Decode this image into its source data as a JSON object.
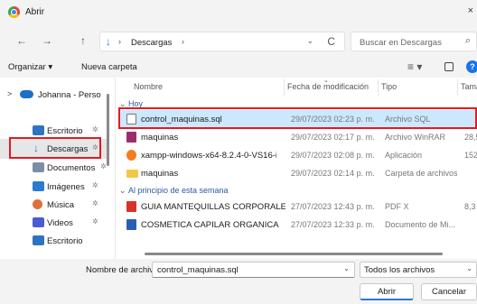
{
  "window": {
    "title": "Abrir",
    "close_glyph": "×"
  },
  "nav": {
    "back_glyph": "←",
    "forward_glyph": "→",
    "up_glyph": "↑",
    "location_icon_glyph": "↓",
    "path_separator": "›",
    "breadcrumb": "Descargas",
    "path_dropdown_glyph": "⌄",
    "refresh_glyph": "C"
  },
  "search": {
    "placeholder": "Buscar en Descargas",
    "icon_glyph": "⌕"
  },
  "toolbar": {
    "organize": "Organizar ▾",
    "new_folder": "Nueva carpeta",
    "view_glyph": "≡ ▾",
    "help_glyph": "?"
  },
  "sidebar": {
    "top_item": {
      "label": "Johanna - Perso",
      "expand_glyph": ">"
    },
    "items": [
      {
        "label": "Escritorio",
        "pin": "✲",
        "color": "#2f74c0"
      },
      {
        "label": "Descargas",
        "pin": "✲",
        "color": "#2b79d0",
        "glyph": "↓"
      },
      {
        "label": "Documentos",
        "pin": "✲",
        "color": "#7a8ea8"
      },
      {
        "label": "Imágenes",
        "pin": "✲",
        "color": "#2b79d0"
      },
      {
        "label": "Música",
        "pin": "✲",
        "color": "#e0703a"
      },
      {
        "label": "Videos",
        "pin": "✲",
        "color": "#4a5bd6"
      },
      {
        "label": "Escritorio",
        "pin": "",
        "color": "#2f74c0"
      }
    ]
  },
  "columns": {
    "name": "Nombre",
    "modified": "Fecha de modificación",
    "type": "Tipo",
    "size": "Tamañ",
    "sort_glyph": "⌄"
  },
  "group_chevron": "⌄",
  "groups": {
    "today": "Hoy",
    "week": "Al principio de esta semana"
  },
  "files_today": [
    {
      "name": "control_maquinas.sql",
      "date": "29/07/2023 02:23 p. m.",
      "type": "Archivo SQL",
      "size": "",
      "color": "#ffffff",
      "border": "#777777"
    },
    {
      "name": "maquinas",
      "date": "29/07/2023 02:17 p. m.",
      "type": "Archivo WinRAR",
      "size": "28,5",
      "color": "#9b2d6f",
      "border": "#9b2d6f"
    },
    {
      "name": "xampp-windows-x64-8.2.4-0-VS16-install...",
      "date": "29/07/2023 02:08 p. m.",
      "type": "Aplicación",
      "size": "152,4",
      "color": "#f27d22",
      "border": "#f27d22"
    },
    {
      "name": "maquinas",
      "date": "29/07/2023 02:14 p. m.",
      "type": "Carpeta de archivos",
      "size": "",
      "color": "#f5c748",
      "border": "#e0a92d"
    }
  ],
  "files_week": [
    {
      "name": "GUIA MANTEQUILLAS CORPORALES",
      "date": "27/07/2023 12:43 p. m.",
      "type": "PDF X",
      "size": "8,3",
      "color": "#d9322a",
      "border": "#d9322a"
    },
    {
      "name": "COSMETICA CAPILAR ORGANICA",
      "date": "27/07/2023 12:33 p. m.",
      "type": "Documento de Mi...",
      "size": "",
      "color": "#2b5fb6",
      "border": "#2b5fb6"
    }
  ],
  "footer": {
    "filename_label": "Nombre de archivo:",
    "filename_value": "control_maquinas.sql",
    "filetype_value": "Todos los archivos",
    "dropdown_glyph": "⌄",
    "open_label": "Abrir",
    "cancel_label": "Cancelar"
  },
  "colors": {
    "highlight": "#e01b24",
    "selection": "#cce8ff",
    "accent": "#2b79d0"
  }
}
